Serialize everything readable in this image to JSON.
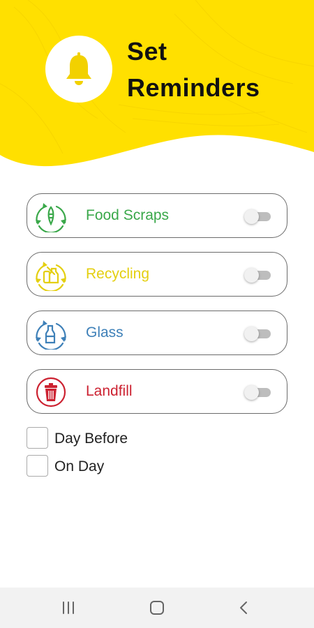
{
  "header": {
    "title_line1": "Set",
    "title_line2": "Reminders",
    "bell_icon": "bell-icon",
    "background_color": "#FFE000"
  },
  "categories": [
    {
      "label": "Food Scraps",
      "icon": "food-scraps-icon",
      "color": "#3aa84a",
      "enabled": false
    },
    {
      "label": "Recycling",
      "icon": "recycling-icon",
      "color": "#e4cf10",
      "enabled": false
    },
    {
      "label": "Glass",
      "icon": "glass-icon",
      "color": "#3e80b8",
      "enabled": false
    },
    {
      "label": "Landfill",
      "icon": "landfill-icon",
      "color": "#cc2231",
      "enabled": false
    }
  ],
  "timing_options": [
    {
      "label": "Day Before",
      "checked": false
    },
    {
      "label": "On Day",
      "checked": false
    }
  ],
  "navbar": {
    "recents_icon": "recents-icon",
    "home_icon": "home-icon",
    "back_icon": "back-icon"
  }
}
